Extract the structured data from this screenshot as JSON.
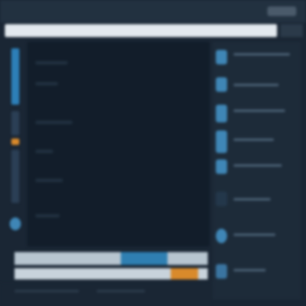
{
  "window": {
    "title": "",
    "action_label": ""
  },
  "address_bar": {
    "value": ""
  },
  "left_rail": {
    "items": [
      {
        "icon": "panel-icon",
        "color": "#2d7fb8"
      },
      {
        "icon": "list-icon",
        "color": "#2b3f55"
      },
      {
        "icon": "flag-icon",
        "color": "#d98a2b"
      },
      {
        "icon": "layers-icon",
        "color": "#2b3f55"
      },
      {
        "icon": "settings-icon",
        "color": "#3f86b6"
      }
    ]
  },
  "right_panel": {
    "items": [
      {
        "icon": "image-icon"
      },
      {
        "icon": "document-icon"
      },
      {
        "icon": "folder-icon"
      },
      {
        "icon": "tag-icon"
      },
      {
        "icon": "user-icon"
      },
      {
        "icon": "share-icon"
      },
      {
        "icon": "download-icon"
      }
    ]
  },
  "bottom": {
    "progress_primary": {
      "color": "#2f7fb2"
    },
    "progress_secondary": {
      "color": "#d98a2b"
    }
  }
}
